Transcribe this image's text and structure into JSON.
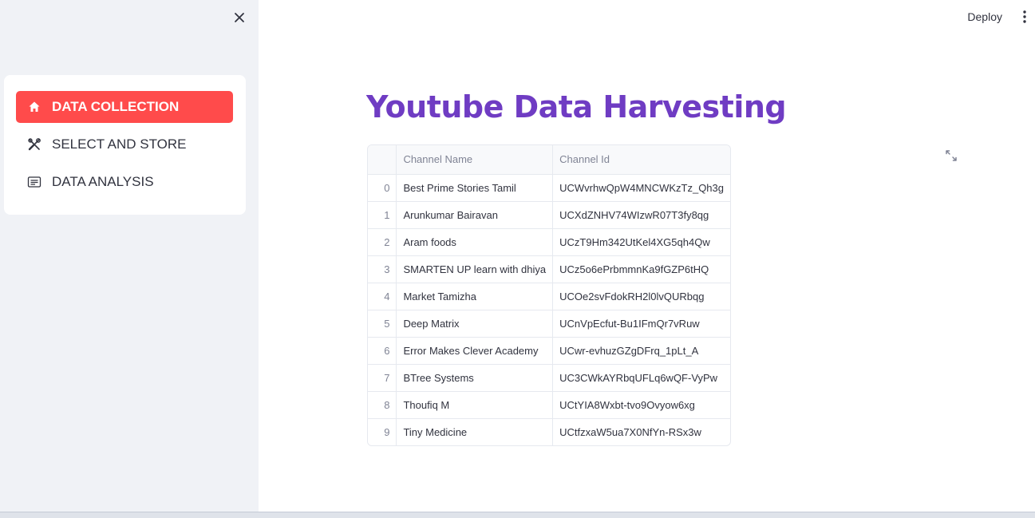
{
  "sidebar": {
    "close_icon": "close-icon",
    "items": [
      {
        "label": "DATA COLLECTION",
        "icon": "house-icon",
        "active": true
      },
      {
        "label": "SELECT AND STORE",
        "icon": "tools-icon",
        "active": false
      },
      {
        "label": "DATA ANALYSIS",
        "icon": "card-text-icon",
        "active": false
      }
    ]
  },
  "header": {
    "deploy_label": "Deploy",
    "menu_icon": "kebab-menu-icon"
  },
  "main": {
    "title": "Youtube Data Harvesting",
    "table": {
      "columns": [
        "",
        "Channel Name",
        "Channel Id"
      ],
      "rows": [
        [
          "0",
          "Best Prime Stories Tamil",
          "UCWvrhwQpW4MNCWKzTz_Qh3g"
        ],
        [
          "1",
          "Arunkumar Bairavan",
          "UCXdZNHV74WIzwR07T3fy8qg"
        ],
        [
          "2",
          "Aram foods",
          "UCzT9Hm342UtKel4XG5qh4Qw"
        ],
        [
          "3",
          "SMARTEN UP learn with dhiya",
          "UCz5o6ePrbmmnKa9fGZP6tHQ"
        ],
        [
          "4",
          "Market Tamizha",
          "UCOe2svFdokRH2l0lvQURbqg"
        ],
        [
          "5",
          "Deep Matrix",
          "UCnVpEcfut-Bu1IFmQr7vRuw"
        ],
        [
          "6",
          "Error Makes Clever Academy",
          "UCwr-evhuzGZgDFrq_1pLt_A"
        ],
        [
          "7",
          "BTree Systems",
          "UC3CWkAYRbqUFLq6wQF-VyPw"
        ],
        [
          "8",
          "Thoufiq M",
          "UCtYIA8Wxbt-tvo9Ovyow6xg"
        ],
        [
          "9",
          "Tiny Medicine",
          "UCtfzxaW5ua7X0NfYn-RSx3w"
        ]
      ]
    },
    "expand_icon": "expand-icon"
  },
  "colors": {
    "accent": "#ff4b4b",
    "title": "#6f3cc3",
    "sidebar_bg": "#f0f2f6"
  }
}
